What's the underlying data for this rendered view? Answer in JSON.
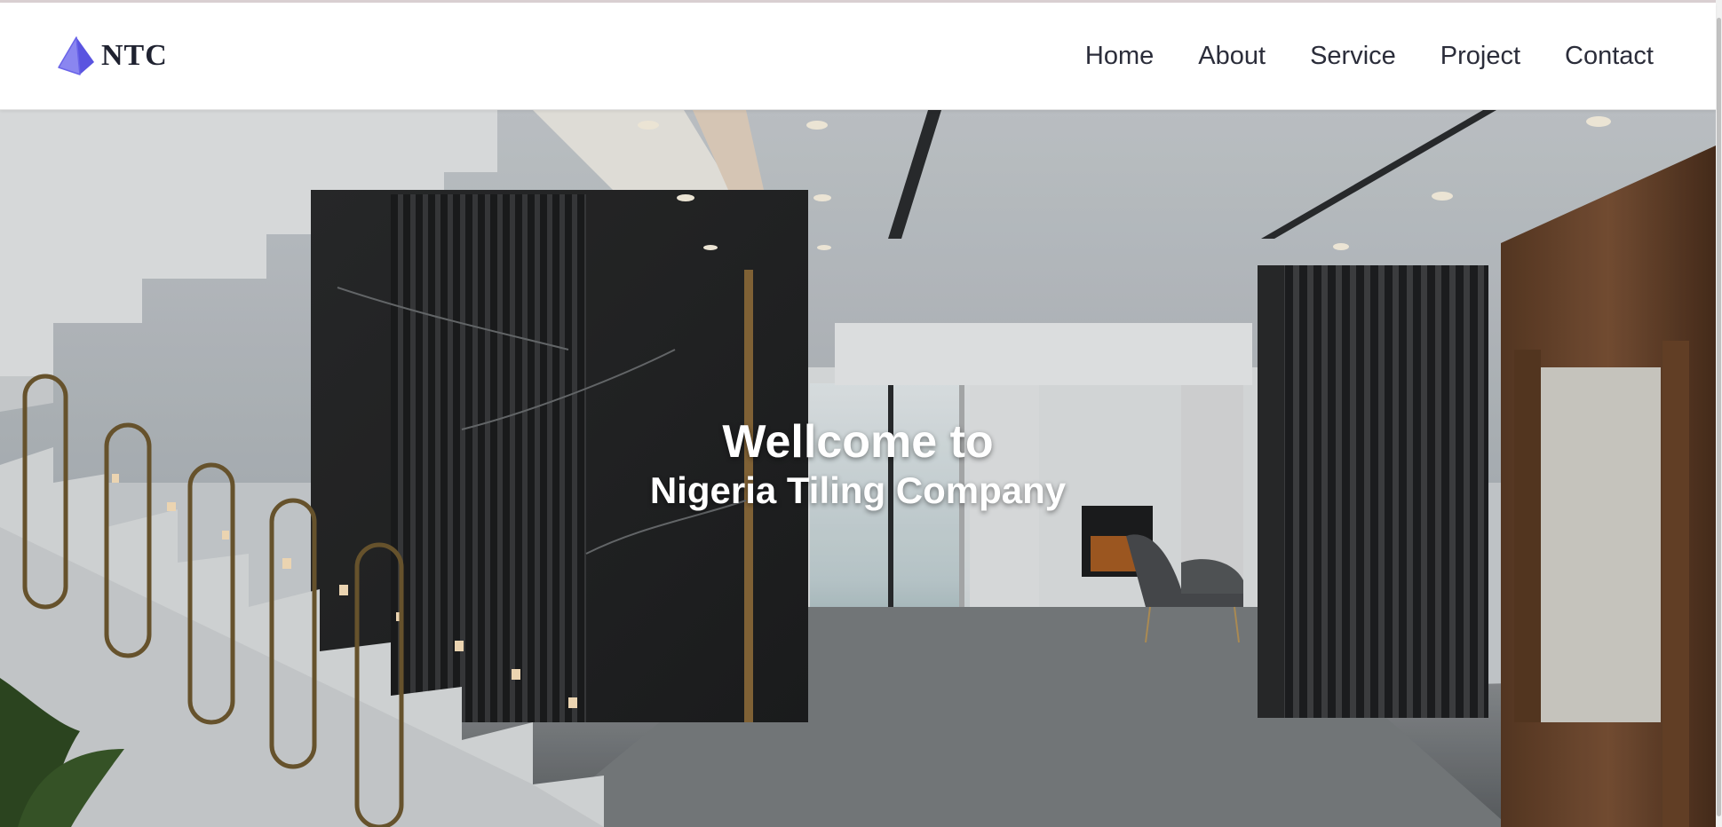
{
  "header": {
    "logo_text": "NTC",
    "logo_icon": "pyramid-logo-icon",
    "nav": [
      {
        "label": "Home"
      },
      {
        "label": "About"
      },
      {
        "label": "Service"
      },
      {
        "label": "Project"
      },
      {
        "label": "Contact"
      }
    ]
  },
  "hero": {
    "title": "Wellcome to",
    "subtitle": "Nigeria Tiling Company"
  },
  "colors": {
    "logo_accent": "#6a64e8",
    "nav_text": "#2b2d3a",
    "hero_text": "#ffffff"
  }
}
